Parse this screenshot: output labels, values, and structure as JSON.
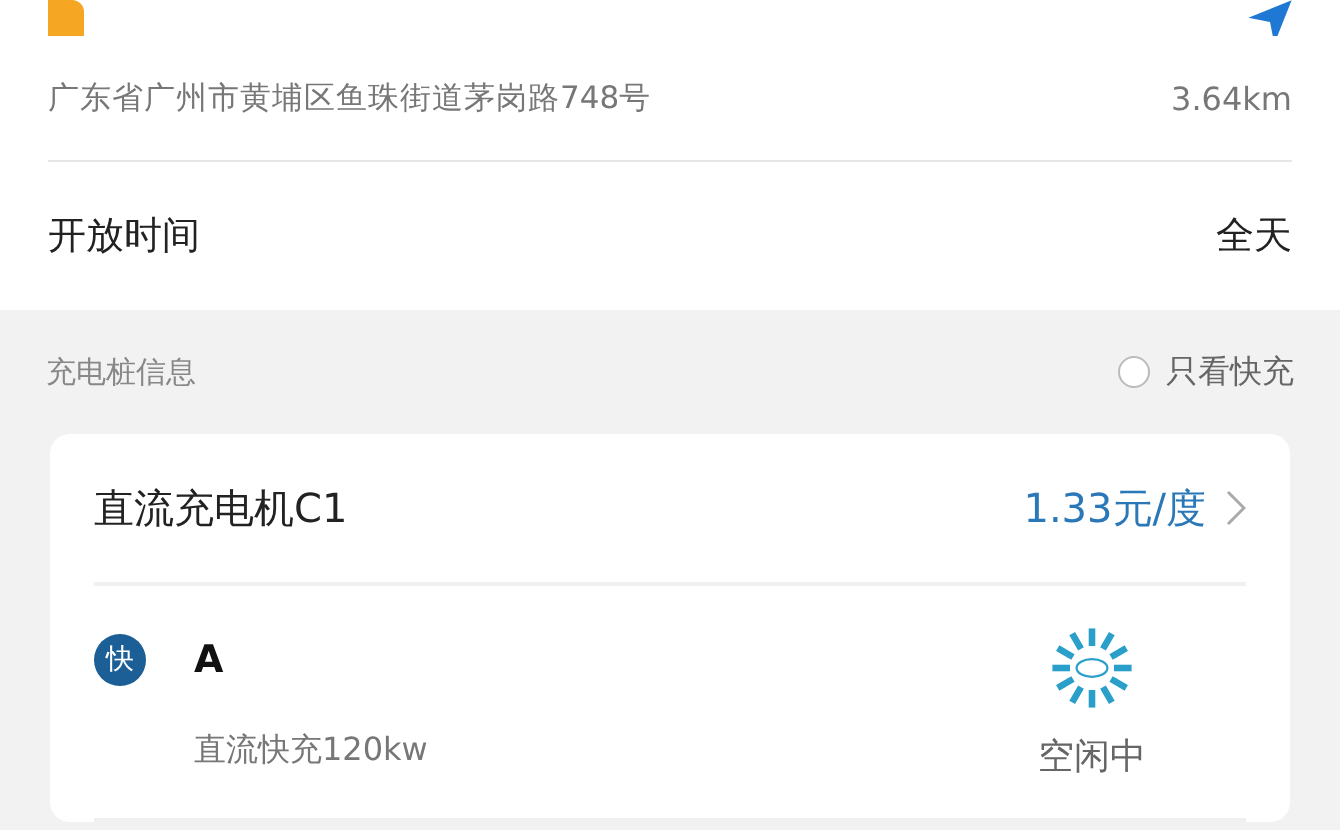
{
  "station": {
    "address": "广东省广州市黄埔区鱼珠街道茅岗路748号",
    "distance": "3.64km"
  },
  "hours": {
    "label": "开放时间",
    "value": "全天"
  },
  "section": {
    "title": "充电桩信息",
    "filter": {
      "label": "只看快充",
      "checked": false
    }
  },
  "charger": {
    "name": "直流充电机C1",
    "price": "1.33元/度",
    "connectors": [
      {
        "badge": "快",
        "name": "A",
        "spec": "直流快充120kw",
        "status": "空闲中",
        "kind": "free"
      }
    ]
  }
}
